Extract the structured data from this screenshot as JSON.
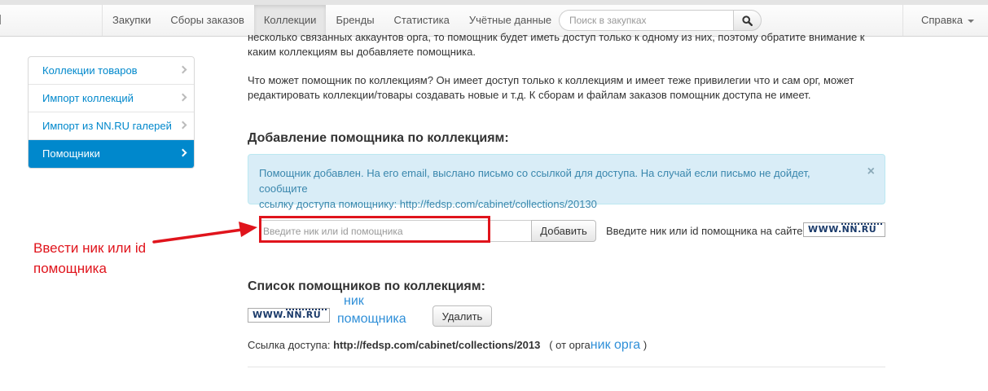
{
  "navbar": {
    "items": [
      {
        "label": "Закупки",
        "active": false
      },
      {
        "label": "Сборы заказов",
        "active": false
      },
      {
        "label": "Коллекции",
        "active": true
      },
      {
        "label": "Бренды",
        "active": false
      },
      {
        "label": "Статистика",
        "active": false
      },
      {
        "label": "Учётные данные",
        "active": false
      }
    ],
    "search_placeholder": "Поиск в закупках",
    "help_label": "Справка"
  },
  "sidebar": {
    "items": [
      {
        "label": "Коллекции товаров",
        "active": false
      },
      {
        "label": "Импорт коллекций",
        "active": false
      },
      {
        "label": "Импорт из NN.RU галерей",
        "active": false
      },
      {
        "label": "Помощники",
        "active": true
      }
    ]
  },
  "content": {
    "intro_line1": "несколько связанных аккаунтов орга, то помощник будет иметь доступ только к одному из них, поэтому обратите внимание к",
    "intro_line2": "каким коллекциям вы добавляете помощника.",
    "rights_line1": "Что может помощник по коллекциям? Он имеет доступ только к коллекциям и имеет теже привилегии что и сам орг, может",
    "rights_line2": "редактировать коллекции/товары создавать новые и т.д. К сборам и файлам заказов помощник доступа не имеет.",
    "add_heading": "Добавление помощника по коллекциям:",
    "alert_line1": "Помощник добавлен. На его email, выслано письмо со ссылкой для доступа. На случай если письмо не дойдет, сообщите",
    "alert_line2": "ссылку доступа помощнику: http://fedsp.com/cabinet/collections/20130",
    "alert_close": "×",
    "input_placeholder": "Введите ник или id помощника",
    "add_button": "Добавить",
    "hint_text": "Введите ник или id помощника на сайте",
    "logo_text": "WWW.NN.RU",
    "list_heading": "Список помощников по коллекциям:",
    "delete_button": "Удалить",
    "access_label": "Ссылка доступа:",
    "access_link": "http://fedsp.com/cabinet/collections/2013",
    "org_prefix": "( от орга",
    "org_suffix": ")"
  },
  "annotations": {
    "arrow_note_line1": "Ввести ник или id",
    "arrow_note_line2": "помощника",
    "nick_line1": "ник",
    "nick_line2": "помощника",
    "org_nick": "ник орга"
  },
  "colors": {
    "accent": "#0088cc",
    "annotation_red": "#e0141c",
    "annotation_blue": "#2f8fd8",
    "alert_bg": "#d9edf7"
  }
}
